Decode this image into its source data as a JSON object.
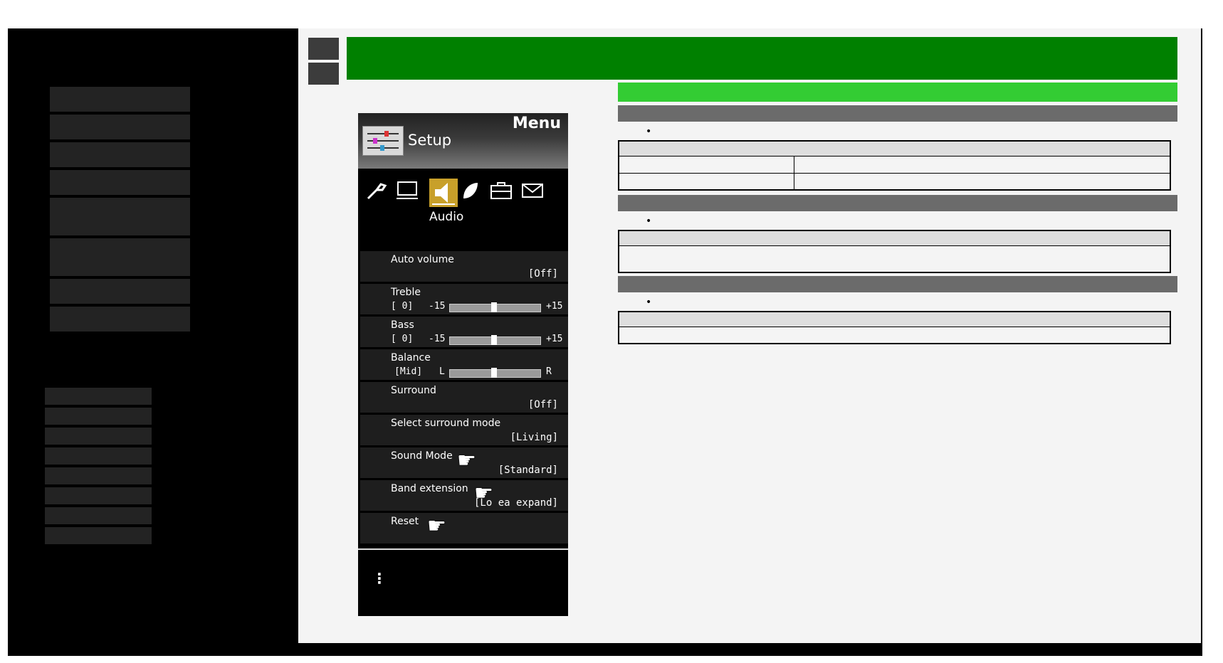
{
  "menu": {
    "title": "Menu",
    "section": "Setup",
    "active_tab": "Audio",
    "tabs": [
      {
        "icon": "wrench-icon"
      },
      {
        "icon": "monitor-icon"
      },
      {
        "icon": "speaker-icon"
      },
      {
        "icon": "leaf-icon"
      },
      {
        "icon": "briefcase-icon"
      },
      {
        "icon": "envelope-icon"
      }
    ],
    "items": [
      {
        "label": "Auto volume",
        "value": "[Off]"
      },
      {
        "label": "Treble",
        "value": "[   0]",
        "min": "-15",
        "max": "+15",
        "level": 0
      },
      {
        "label": "Bass",
        "value": "[   0]",
        "min": "-15",
        "max": "+15",
        "level": 0
      },
      {
        "label": "Balance",
        "value": "[Mid]",
        "min": "L",
        "max": "R",
        "level": 0
      },
      {
        "label": "Surround",
        "value": "[Off]"
      },
      {
        "label": "Select surround mode",
        "value": "[Living]"
      },
      {
        "label": "Sound Mode",
        "value": "[Standard]"
      },
      {
        "label": "Band extension",
        "value": "[Lo   ea expand]"
      },
      {
        "label": "Reset",
        "value": ""
      }
    ],
    "more": "⋮"
  },
  "content": {
    "bullets": [
      "•",
      "•",
      "•"
    ]
  },
  "colors": {
    "header": "#008000",
    "subheader": "#33cc33",
    "section": "#6b6b6b",
    "audio_tab_highlight": "#c8a02a"
  }
}
